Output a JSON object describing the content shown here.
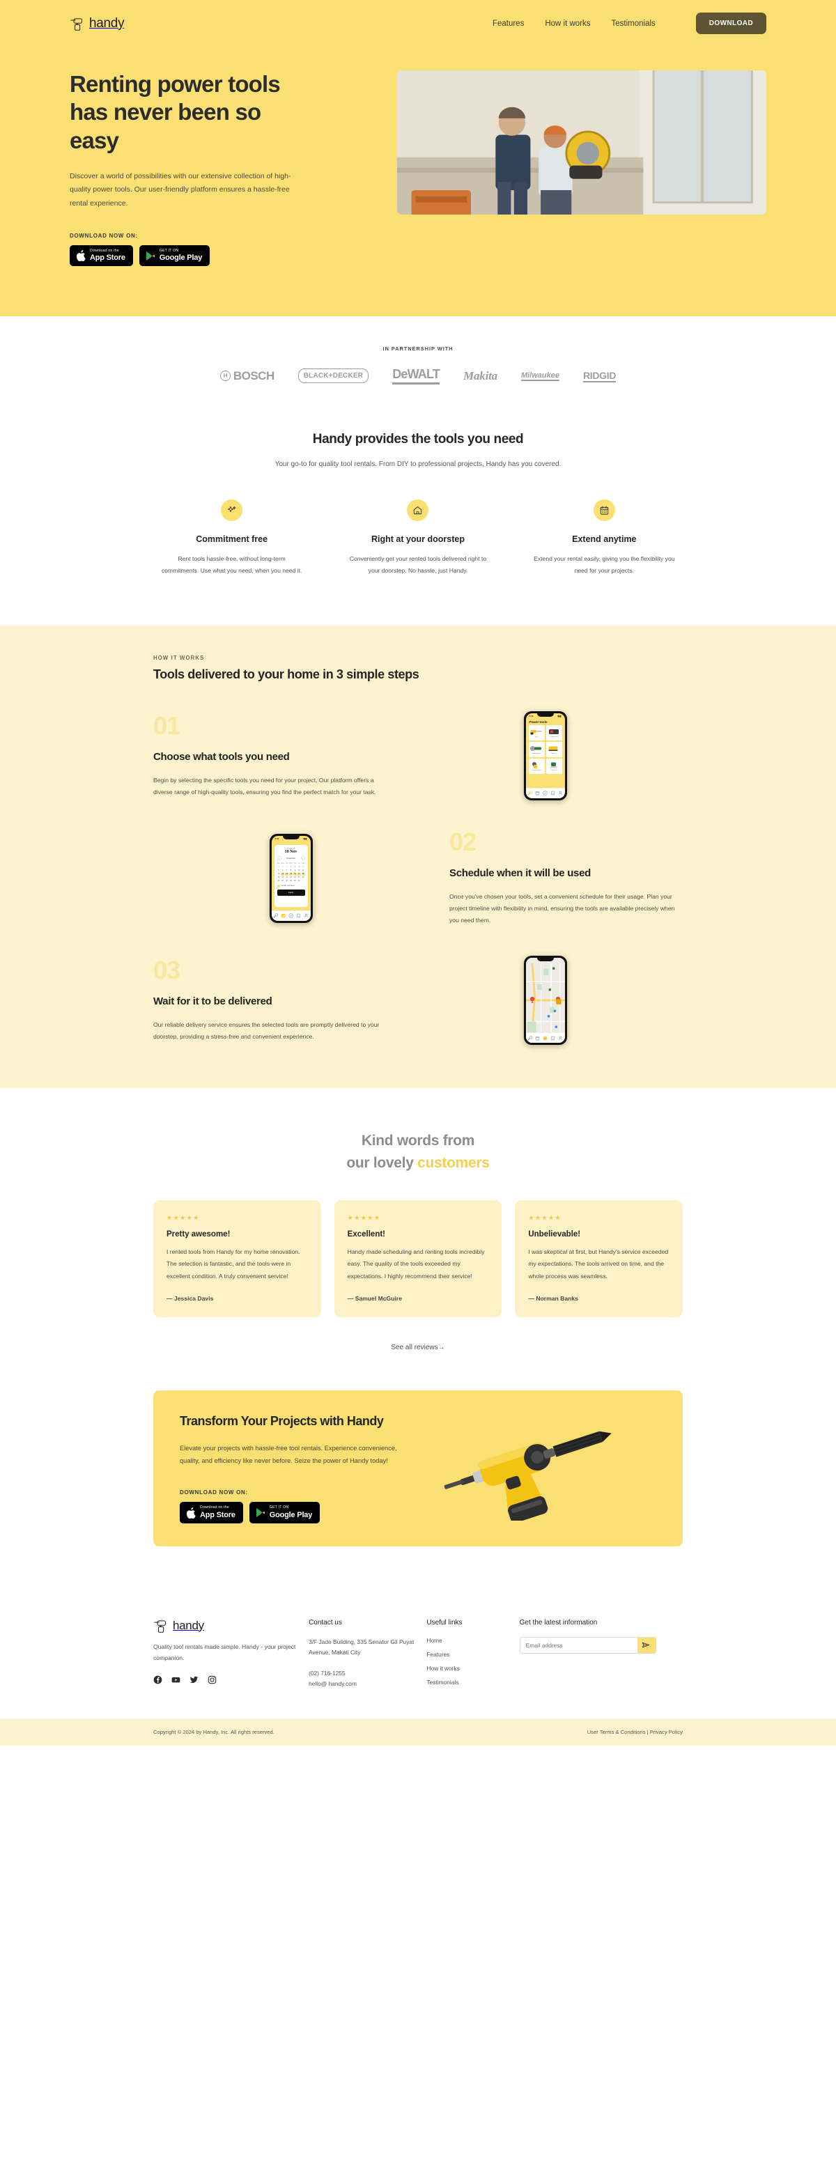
{
  "brand": {
    "name": "handy",
    "logo_icon": "drill-icon"
  },
  "header": {
    "nav": [
      {
        "label": "Features"
      },
      {
        "label": "How it works"
      },
      {
        "label": "Testimonials"
      }
    ],
    "download_button": "DOWNLOAD"
  },
  "hero": {
    "heading": "Renting power tools has never been so easy",
    "paragraph": "Discover a world of possibilities with our extensive collection of high-quality power tools. Our user-friendly platform ensures a hassle-free rental experience.",
    "download_label": "DOWNLOAD NOW ON:",
    "app_store": {
      "small": "Download on the",
      "big": "App Store",
      "icon": "apple-icon"
    },
    "google_play": {
      "small": "GET IT ON",
      "big": "Google Play",
      "icon": "google-play-icon"
    },
    "image_alt": "Two workers using power tools in a kitchen renovation",
    "bg_color": "#fadf72"
  },
  "partners": {
    "label": "IN PARTNERSHIP WITH",
    "brands": [
      "BOSCH",
      "BLACK+DECKER",
      "DeWALT",
      "Makita",
      "Milwaukee",
      "RIDGID"
    ]
  },
  "features": {
    "title": "Handy provides the tools you need",
    "subtitle": "Your go-to for quality tool rentals. From DIY to professional projects, Handy has you covered.",
    "items": [
      {
        "icon": "sparkles-icon",
        "title": "Commitment free",
        "text": "Rent tools hassle-free, without long-term commitments. Use what you need, when you need it."
      },
      {
        "icon": "house-icon",
        "title": "Right at your doorstep",
        "text": "Conveniently get your rented tools delivered right to your doorstep. No hassle, just Handy."
      },
      {
        "icon": "calendar-icon",
        "title": "Extend anytime",
        "text": "Extend your rental easily, giving you the flexibility you need for your projects."
      }
    ]
  },
  "how_it_works": {
    "eyebrow": "HOW IT WORKS",
    "title": "Tools delivered to your home in 3 simple steps",
    "steps": [
      {
        "number": "01",
        "title": "Choose what tools you need",
        "text": "Begin by selecting the specific tools you need for your project. Our platform offers a diverse range of high-quality tools, ensuring you find the perfect match for your task.",
        "screen": "tools-grid"
      },
      {
        "number": "02",
        "title": "Schedule when it will be used",
        "text": "Once you've chosen your tools, set a convenient schedule for their usage. Plan your project timeline with flexibility in mind, ensuring the tools are available precisely when you need them.",
        "screen": "calendar"
      },
      {
        "number": "03",
        "title": "Wait for it to be delivered",
        "text": "Our reliable delivery service ensures the selected tools are promptly delivered to your doorstep, providing a stress-free and convenient experience.",
        "screen": "map"
      }
    ]
  },
  "phone_tools": {
    "time": "9:41",
    "title": "Power tools",
    "items": [
      {
        "label": "Saws"
      },
      {
        "label": "Cordless tools"
      },
      {
        "label": "Angle grinders"
      },
      {
        "label": "Sanders"
      },
      {
        "label": "Cut-off grinders"
      },
      {
        "label": "Routers"
      }
    ],
    "tabs": [
      "wrench-icon",
      "calendar-icon",
      "check-circle-icon",
      "bookmark-icon",
      "person-icon"
    ]
  },
  "phone_calendar": {
    "time": "9:41",
    "label": "Check out",
    "date": "18 Nov",
    "month": "November",
    "dow": [
      "Sun",
      "Mon",
      "Tue",
      "Wed",
      "Thu",
      "Fri",
      "Sat"
    ],
    "weeks": [
      [
        "28",
        "29",
        "30",
        "1",
        "2",
        "3",
        "4"
      ],
      [
        "5",
        "6",
        "7",
        "8",
        "9",
        "10",
        "11"
      ],
      [
        "12",
        "13",
        "14",
        "15",
        "16",
        "17",
        "18"
      ],
      [
        "19",
        "20",
        "21",
        "22",
        "23",
        "24",
        "25"
      ],
      [
        "26",
        "27",
        "28",
        "29",
        "30",
        "31",
        "1"
      ]
    ],
    "flexible_label": "Flexible with dates",
    "apply_label": "Apply"
  },
  "phone_map": {
    "time": "9:41",
    "places": [
      "Las Palmas Park",
      "Serra Park",
      "Apple Infinite Loop",
      "Target",
      "De Anza College",
      "The Home Depot",
      "Cupertino"
    ]
  },
  "testimonials": {
    "title_line1": "Kind words from",
    "title_line2_plain": "our lovely ",
    "title_line2_accent": "customers",
    "accent_color": "#f5cf52",
    "cards": [
      {
        "stars": "★★★★★",
        "title": "Pretty awesome!",
        "text": "I rented tools from Handy for my home renovation. The selection is fantastic, and the tools were in excellent condition. A truly convenient service!",
        "author": "— Jessica Davis"
      },
      {
        "stars": "★★★★★",
        "title": "Excellent!",
        "text": "Handy made scheduling and renting tools incredibly easy. The quality of the tools exceeded my expectations. I highly recommend their service!",
        "author": "— Samuel McGuire"
      },
      {
        "stars": "★★★★★",
        "title": "Unbelievable!",
        "text": "I was skeptical at first, but Handy's service exceeded my expectations. The tools arrived on time, and the whole process was seamless.",
        "author": "— Norman Banks"
      }
    ],
    "see_all": "See all reviews→"
  },
  "cta": {
    "heading": "Transform Your Projects with Handy",
    "text": "Elevate your projects with hassle-free tool rentals. Experience convenience, quality, and efficiency like never before. Seize the power of Handy today!",
    "download_label": "DOWNLOAD NOW ON:",
    "app_store": {
      "small": "Download on the",
      "big": "App Store"
    },
    "google_play": {
      "small": "GET IT ON",
      "big": "Google Play"
    },
    "art_alt": "Yellow cordless drill with a long bit"
  },
  "footer": {
    "tagline": "Quality tool rentals made simple. Handy - your project companion.",
    "socials": [
      "facebook-icon",
      "youtube-icon",
      "twitter-icon",
      "instagram-icon"
    ],
    "contact": {
      "heading": "Contact us",
      "address": "3/F Jade Building, 335 Senator Gil Puyat Avenue, Makati City",
      "phone": "(02) 716-1255",
      "email": "hello@ handy.com"
    },
    "useful": {
      "heading": "Useful links",
      "links": [
        "Home",
        "Features",
        "How it works",
        "Testimonials"
      ]
    },
    "newsletter": {
      "heading": "Get the latest information",
      "placeholder": "Email address",
      "value": "",
      "submit_icon": "send-icon"
    },
    "bottom": {
      "copyright": "Copyright © 2024 by Handy, Inc. All rights reserved.",
      "terms": "User Terms & Conditions",
      "separator": " | ",
      "privacy": "Privacy Policy"
    }
  }
}
